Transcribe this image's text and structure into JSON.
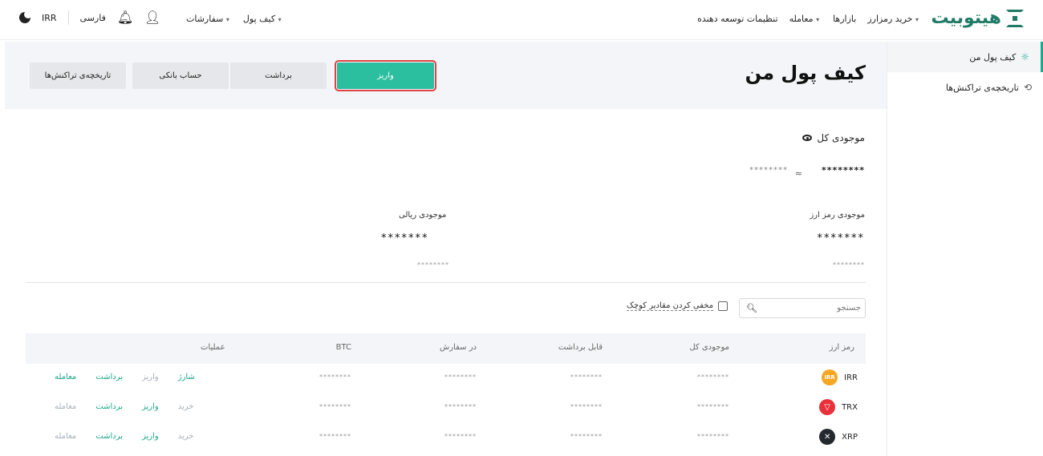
{
  "header": {
    "logo_text": "هیتوبیت",
    "nav": [
      {
        "label": "خرید رمزارز",
        "caret": true
      },
      {
        "label": "بازارها",
        "caret": false
      },
      {
        "label": "معامله",
        "caret": true
      },
      {
        "label": "تنظیمات توسعه دهنده",
        "caret": false
      }
    ],
    "wallet_menu": "کیف پول",
    "orders_menu": "سفارشات",
    "language": "فارسی",
    "currency": "IRR",
    "icons": [
      "user-icon",
      "bell-icon",
      "moon-icon"
    ]
  },
  "sidebar": {
    "items": [
      {
        "label": "کیف پول من",
        "icon": "wallet-sun-icon",
        "active": true
      },
      {
        "label": "تاریخچه‌ی تراکنش‌ها",
        "icon": "history-icon",
        "active": false
      }
    ]
  },
  "hero": {
    "title": "کیف پول من",
    "buttons": {
      "deposit": "واریز",
      "withdraw": "برداشت",
      "bank": "حساب بانکی",
      "history": "تاریخچه‌ی تراکنش‌ها"
    }
  },
  "balance": {
    "total_label": "موجودی کل",
    "total_value": "********",
    "approx": "≈",
    "sub_value": "********",
    "crypto_label": "موجودی رمز ارز",
    "crypto_value": "*******",
    "crypto_small": "********",
    "rial_label": "موجودی ریالی",
    "rial_value": "*******",
    "rial_small": "********"
  },
  "filters": {
    "search_placeholder": "جستجو",
    "hide_small": "مخفی کردن مقادیر کوچک"
  },
  "table": {
    "headers": {
      "coin": "رمز ارز",
      "total": "موجودی کل",
      "withdrawable": "قابل برداشت",
      "in_order": "در سفارش",
      "btc": "BTC",
      "ops": "عملیات"
    },
    "rows": [
      {
        "symbol": "IRR",
        "icon_text": "IRR",
        "color": "#f5a623",
        "total": "********",
        "withdrawable": "********",
        "in_order": "********",
        "btc": "********",
        "ops": [
          {
            "label": "معامله",
            "style": "green"
          },
          {
            "label": "برداشت",
            "style": "green"
          },
          {
            "label": "واریز",
            "style": "muted"
          },
          {
            "label": "شارژ",
            "style": "green"
          }
        ]
      },
      {
        "symbol": "TRX",
        "icon_text": "▽",
        "color": "#e8313a",
        "total": "********",
        "withdrawable": "********",
        "in_order": "********",
        "btc": "********",
        "ops": [
          {
            "label": "معامله",
            "style": "muted"
          },
          {
            "label": "برداشت",
            "style": "green"
          },
          {
            "label": "واریز",
            "style": "green"
          },
          {
            "label": "خرید",
            "style": "muted"
          }
        ]
      },
      {
        "symbol": "XRP",
        "icon_text": "✕",
        "color": "#23292f",
        "total": "********",
        "withdrawable": "********",
        "in_order": "********",
        "btc": "********",
        "ops": [
          {
            "label": "معامله",
            "style": "muted"
          },
          {
            "label": "برداشت",
            "style": "green"
          },
          {
            "label": "واریز",
            "style": "green"
          },
          {
            "label": "خرید",
            "style": "muted"
          }
        ]
      }
    ]
  }
}
